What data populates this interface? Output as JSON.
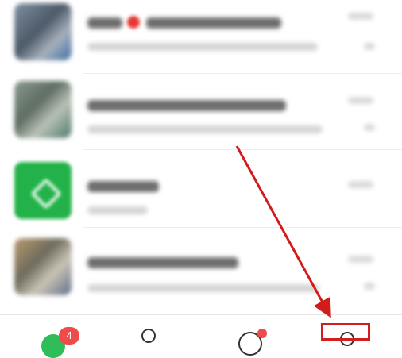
{
  "tabbar": {
    "chat_badge": "4"
  },
  "colors": {
    "wechat_green": "#23b24a",
    "badge_red": "#f04b4b",
    "annotation_red": "#cf1f1f"
  },
  "icons": [
    "chat-icon",
    "contacts-icon",
    "discover-icon",
    "me-icon"
  ]
}
